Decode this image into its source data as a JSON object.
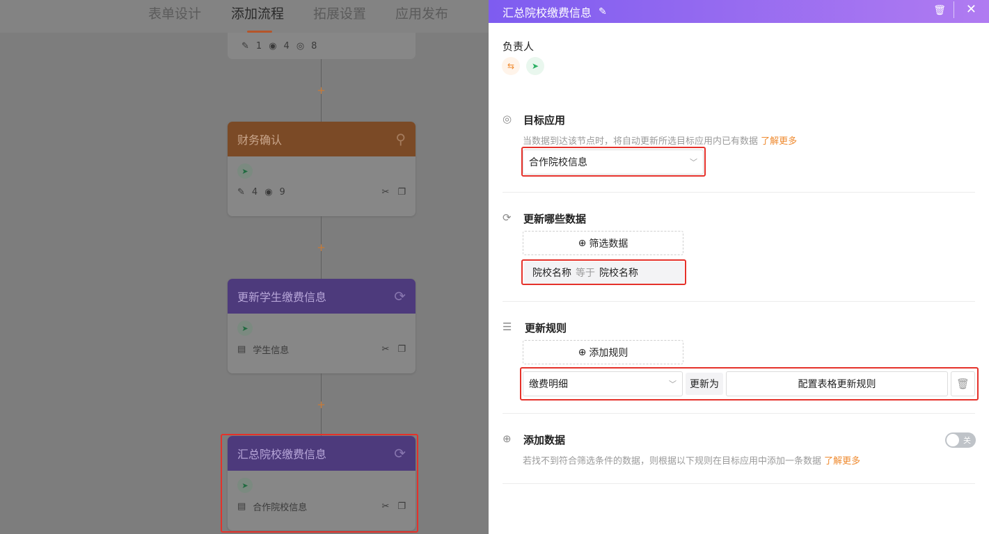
{
  "nav": {
    "tabs": [
      {
        "label": "表单设计"
      },
      {
        "label": "添加流程"
      },
      {
        "label": "拓展设置"
      },
      {
        "label": "应用发布"
      }
    ]
  },
  "flow": {
    "top_card": {
      "edit_count": "1",
      "view_count": "4",
      "read_count": "8"
    },
    "cards": [
      {
        "title": "财务确认",
        "edit_count": "4",
        "view_count": "9"
      },
      {
        "title": "更新学生缴费信息",
        "target": "学生信息"
      },
      {
        "title": "汇总院校缴费信息",
        "target": "合作院校信息"
      }
    ],
    "plus_symbol": "+"
  },
  "panel": {
    "title": "汇总院校缴费信息",
    "owner_label": "负责人",
    "target_app": {
      "title": "目标应用",
      "hint": "当数据到达该节点时，将自动更新所选目标应用内已有数据",
      "learn_more": "了解更多",
      "selected": "合作院校信息"
    },
    "which_data": {
      "title": "更新哪些数据",
      "filter_button": "筛选数据",
      "condition": {
        "field": "院校名称",
        "op": "等于",
        "value": "院校名称"
      }
    },
    "rules": {
      "title": "更新规则",
      "add_button": "添加规则",
      "rule": {
        "field": "缴费明细",
        "update_to": "更新为",
        "config": "配置表格更新规则"
      }
    },
    "add_data": {
      "title": "添加数据",
      "hint": "若找不到符合筛选条件的数据，则根据以下规则在目标应用中添加一条数据",
      "learn_more": "了解更多",
      "toggle_label": "关",
      "toggle_on": false
    }
  },
  "colors": {
    "accent_orange": "#ef8a2f",
    "header_gradient_start": "#7e5cf0",
    "header_gradient_end": "#b07bf1",
    "highlight_red": "#e5312a"
  }
}
